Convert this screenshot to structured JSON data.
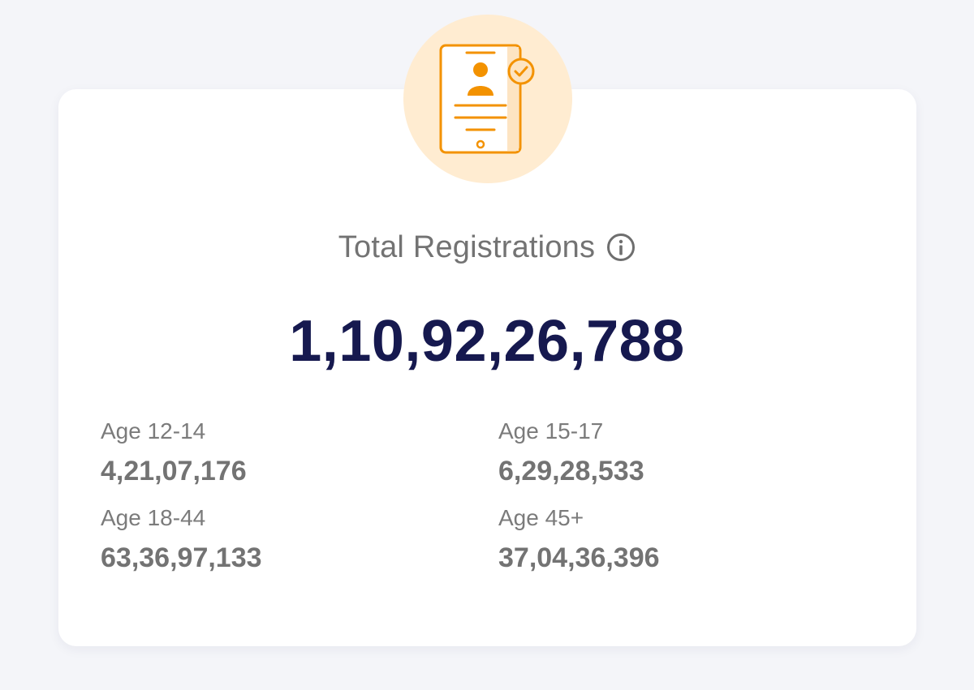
{
  "summary": {
    "title": "Total Registrations",
    "total": "1,10,92,26,788",
    "icon": "registration-phone-icon",
    "info_icon": "info-icon",
    "accent_color": "#f39200",
    "badge_color": "#ffecd1",
    "total_color": "#16194f"
  },
  "breakdown": [
    {
      "label": "Age 12-14",
      "value": "4,21,07,176"
    },
    {
      "label": "Age 15-17",
      "value": "6,29,28,533"
    },
    {
      "label": "Age 18-44",
      "value": "63,36,97,133"
    },
    {
      "label": "Age 45+",
      "value": "37,04,36,396"
    }
  ]
}
